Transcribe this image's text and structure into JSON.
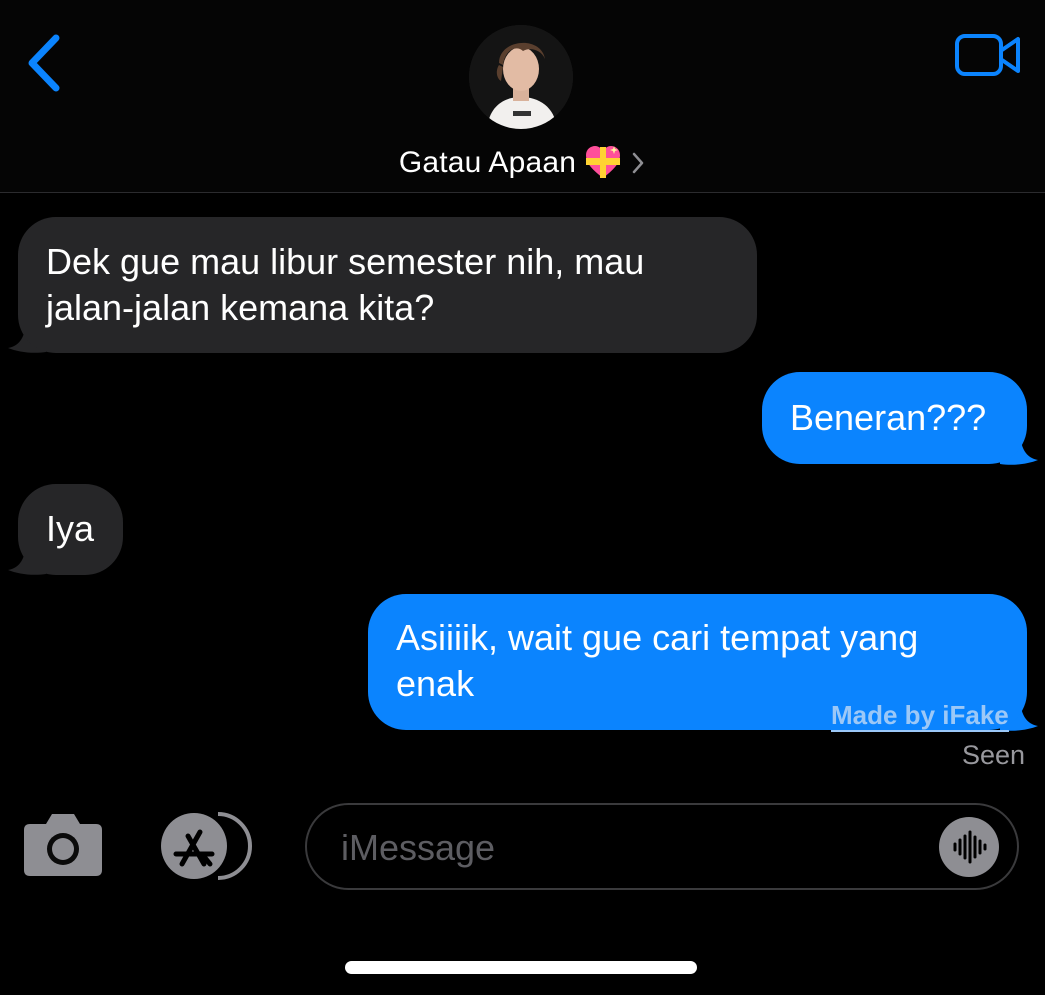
{
  "header": {
    "contact_name": "Gatau Apaan",
    "back_icon": "chevron-left-icon",
    "video_icon": "video-camera-icon",
    "emoji_icon": "sparkling-heart-icon",
    "chevron_icon": "chevron-right-icon"
  },
  "messages": [
    {
      "direction": "incoming",
      "line1": "Dek gue mau libur semester nih, mau",
      "line2": "jalan-jalan kemana kita?"
    },
    {
      "direction": "outgoing",
      "line1": "Beneran???"
    },
    {
      "direction": "incoming",
      "line1": "Iya"
    },
    {
      "direction": "outgoing",
      "line1": "Asiiiik, wait gue cari tempat yang",
      "line2": "enak"
    }
  ],
  "watermark": "Made by iFake",
  "status": "Seen",
  "input": {
    "placeholder": "iMessage",
    "camera_icon": "camera-icon",
    "appstore_icon": "app-store-icon",
    "mic_icon": "audio-waveform-icon"
  },
  "colors": {
    "accent": "#0b84fe",
    "incoming_bubble": "#262628",
    "background": "#000000"
  }
}
